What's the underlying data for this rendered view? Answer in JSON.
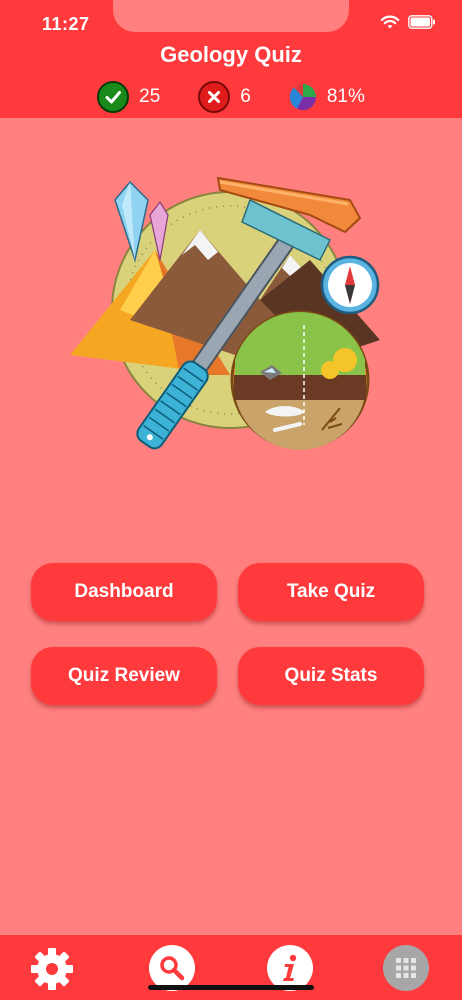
{
  "status_bar": {
    "time": "11:27"
  },
  "header": {
    "title": "Geology Quiz",
    "stats": {
      "correct": "25",
      "wrong": "6",
      "percent": "81%"
    }
  },
  "buttons": {
    "dashboard": "Dashboard",
    "take_quiz": "Take Quiz",
    "quiz_review": "Quiz Review",
    "quiz_stats": "Quiz Stats"
  },
  "tabbar": {
    "icons": [
      "gear-icon",
      "search-icon",
      "info-icon",
      "grid-icon"
    ]
  },
  "colors": {
    "header_bg": "#ff3a3d",
    "body_bg": "#ff807e",
    "correct_green": "#1a8a1a",
    "wrong_red": "#e01b1b"
  }
}
